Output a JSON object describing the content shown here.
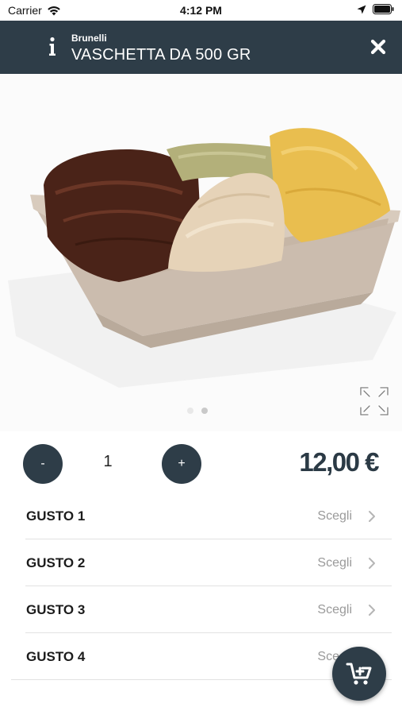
{
  "status_bar": {
    "carrier": "Carrier",
    "time": "4:12 PM"
  },
  "header": {
    "brand": "Brunelli",
    "title": "VASCHETTA DA 500 GR"
  },
  "icons": {
    "info": "info-icon",
    "close": "close-icon",
    "expand": "expand-icon",
    "chevron": "chevron-right-icon",
    "cart": "add-to-cart-icon"
  },
  "carousel": {
    "page_count": 2,
    "active_page": 2
  },
  "quantity": {
    "minus_label": "-",
    "value": "1",
    "plus_label": "+"
  },
  "price": "12,00 €",
  "flavors": [
    {
      "label": "GUSTO 1",
      "action": "Scegli"
    },
    {
      "label": "GUSTO 2",
      "action": "Scegli"
    },
    {
      "label": "GUSTO 3",
      "action": "Scegli"
    },
    {
      "label": "GUSTO 4",
      "action": "Scegli"
    }
  ],
  "colors": {
    "primary": "#2e3d48",
    "muted_text": "#9a9a9a"
  }
}
